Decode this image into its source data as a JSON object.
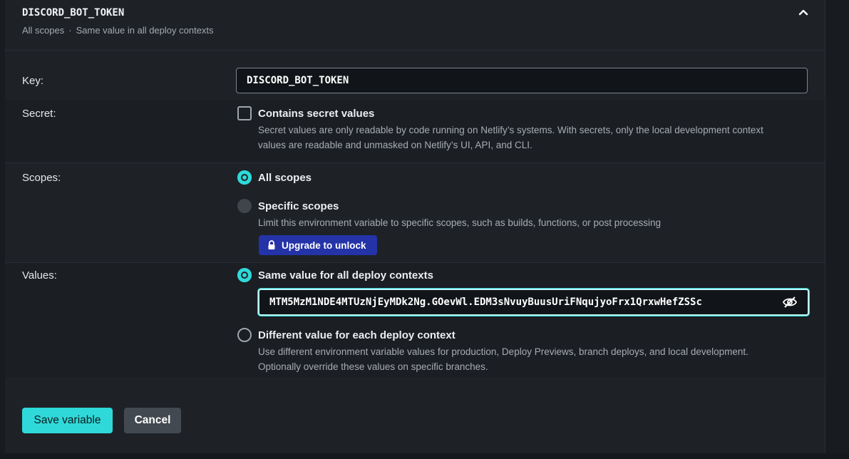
{
  "header": {
    "variable_name": "DISCORD_BOT_TOKEN",
    "scope_summary": "All scopes",
    "separator": "·",
    "context_summary": "Same value in all deploy contexts",
    "collapse_icon": "chevron-up-icon"
  },
  "key_row": {
    "label": "Key:",
    "value": "DISCORD_BOT_TOKEN"
  },
  "secret_row": {
    "label": "Secret:",
    "checkbox_label": "Contains secret values",
    "checked": false,
    "description_line1": "Secret values are only readable by code running on Netlify’s systems. With secrets, only the local development context",
    "description_line2": "values are readable and unmasked on Netlify’s UI, API, and CLI."
  },
  "scopes_row": {
    "label": "Scopes:",
    "options": [
      {
        "label": "All scopes",
        "selected": true
      },
      {
        "label": "Specific scopes",
        "selected": false,
        "disabled": true,
        "description": "Limit this environment variable to specific scopes, such as builds, functions, or post processing"
      }
    ],
    "upgrade_label": "Upgrade to unlock",
    "upgrade_icon": "lock-icon"
  },
  "values_row": {
    "label": "Values:",
    "same_value_label": "Same value for all deploy contexts",
    "token_value": "MTM5MzM1NDE4MTUzNjEyMDk2Ng.GOevWl.EDM3sNvuyBuusUriFNqujyoFrx1QrxwHefZSSc",
    "visibility_icon": "eye-off-icon",
    "different_value_label": "Different value for each deploy context",
    "different_desc_line1": "Use different environment variable values for production, Deploy Previews, branch deploys, and local development.",
    "different_desc_line2": "Optionally override these values on specific branches."
  },
  "actions": {
    "save_label": "Save variable",
    "cancel_label": "Cancel"
  },
  "colors": {
    "accent": "#2fd9d9",
    "upgrade": "#2433a8",
    "panel": "#1e2227"
  }
}
